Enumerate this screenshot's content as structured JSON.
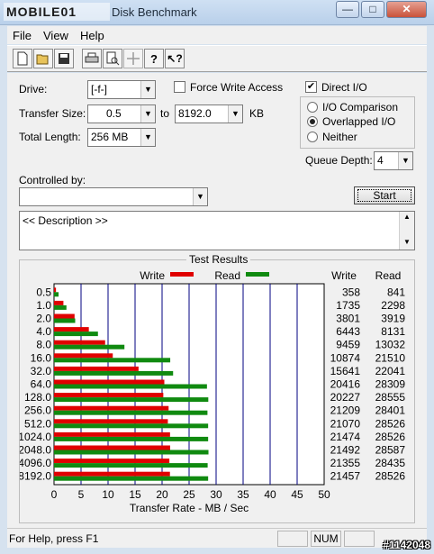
{
  "window": {
    "logo_text": "MOBILE01",
    "title": "Disk Benchmark",
    "minimize": "—",
    "maximize": "□",
    "close": "✕"
  },
  "menu": [
    "File",
    "View",
    "Help"
  ],
  "toolbar": [
    {
      "name": "new-icon",
      "glyph": "🗋"
    },
    {
      "name": "open-icon",
      "glyph": "📂"
    },
    {
      "name": "save-icon",
      "glyph": "💾"
    },
    {
      "name": "print-icon",
      "glyph": "🖶"
    },
    {
      "name": "print-preview-icon",
      "glyph": "🔍"
    },
    {
      "name": "move-icon",
      "glyph": "✥"
    },
    {
      "name": "about-icon",
      "glyph": "?"
    },
    {
      "name": "context-help-icon",
      "glyph": "↖?"
    }
  ],
  "form": {
    "drive_label": "Drive:",
    "drive_value": "[-f-]",
    "force_write_label": "Force Write Access",
    "direct_io_label": "Direct I/O",
    "transfer_size_label": "Transfer Size:",
    "transfer_from": "0.5",
    "to_label": "to",
    "transfer_to": "8192.0",
    "kb_label": "KB",
    "total_length_label": "Total Length:",
    "total_length_value": "256 MB",
    "io_comparison_label": "I/O Comparison",
    "overlapped_io_label": "Overlapped I/O",
    "neither_label": "Neither",
    "queue_depth_label": "Queue Depth:",
    "queue_depth_value": "4",
    "controlled_by_label": "Controlled by:",
    "controlled_by_value": "",
    "start_label": "Start",
    "description_text": "<< Description >>"
  },
  "colors": {
    "write": "#e00000",
    "read": "#108a10",
    "grid": "#000080"
  },
  "chart_data": {
    "type": "bar",
    "title": "Test Results",
    "xlabel": "Transfer Rate - MB / Sec",
    "xlim": [
      0,
      50
    ],
    "xticks": [
      "0",
      "5",
      "10",
      "15",
      "20",
      "25",
      "30",
      "35",
      "40",
      "45",
      "50"
    ],
    "categories": [
      "0.5",
      "1.0",
      "2.0",
      "4.0",
      "8.0",
      "16.0",
      "32.0",
      "64.0",
      "128.0",
      "256.0",
      "512.0",
      "1024.0",
      "2048.0",
      "4096.0",
      "8192.0"
    ],
    "series": [
      {
        "name": "Write",
        "values": [
          358,
          1735,
          3801,
          6443,
          9459,
          10874,
          15641,
          20416,
          20227,
          21209,
          21070,
          21474,
          21492,
          21355,
          21457
        ]
      },
      {
        "name": "Read",
        "values": [
          841,
          2298,
          3919,
          8131,
          13032,
          21510,
          22041,
          28309,
          28555,
          28401,
          28526,
          28526,
          28587,
          28435,
          28526
        ]
      }
    ],
    "value_unit_divisor": 1000,
    "table_headers": [
      "Write",
      "Read"
    ]
  },
  "status": {
    "help_text": "For Help, press F1",
    "num": "NUM",
    "watermark": "#1142048"
  }
}
